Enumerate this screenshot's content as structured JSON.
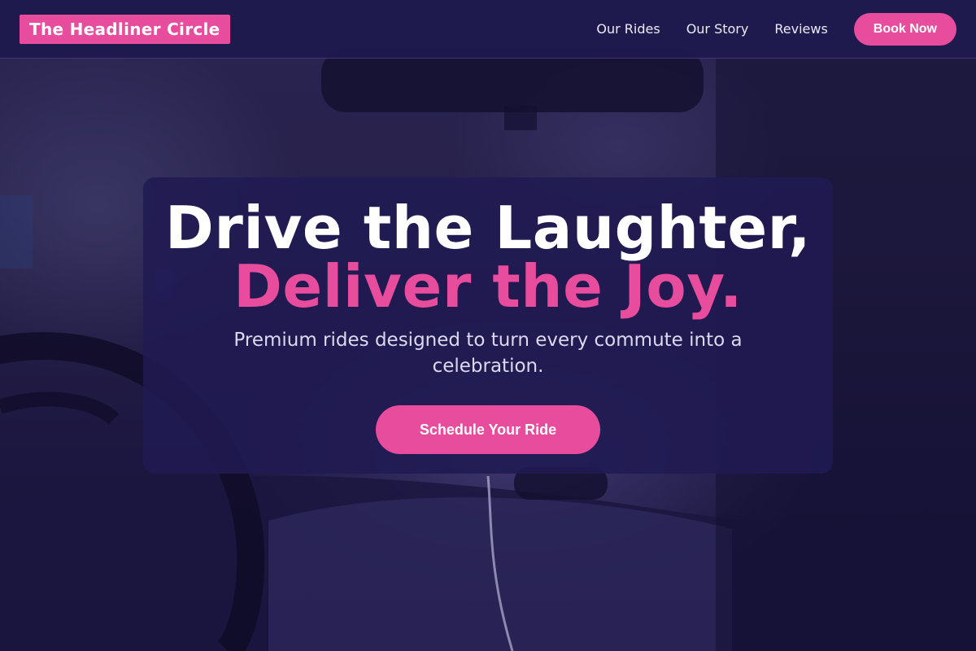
{
  "header": {
    "logo_text": "The Headliner Circle",
    "nav": [
      {
        "label": "Our Rides"
      },
      {
        "label": "Our Story"
      },
      {
        "label": "Reviews"
      }
    ],
    "cta_label": "Book Now"
  },
  "hero": {
    "headline_line1": "Drive the Laughter,",
    "headline_line2": "Deliver the Joy.",
    "subtitle": "Premium rides designed to turn every commute into a celebration.",
    "cta_label": "Schedule Your Ride"
  },
  "colors": {
    "accent": "#e74d9c",
    "header_bg": "#1e1a4e",
    "card_bg": "#201a52",
    "text_primary": "#ffffff",
    "text_secondary": "#dcd9ee"
  }
}
